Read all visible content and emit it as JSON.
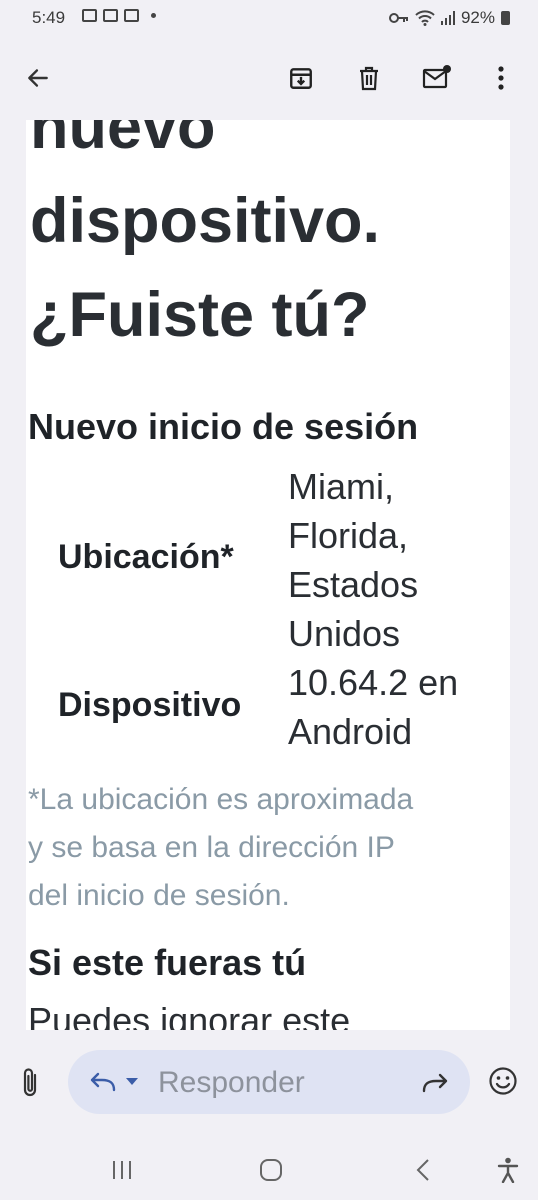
{
  "status_bar": {
    "time": "5:49",
    "battery": "92%"
  },
  "app_bar": {
    "icons": [
      "back-arrow-icon",
      "archive-icon",
      "trash-icon",
      "mark-unread-icon",
      "more-vert-icon"
    ]
  },
  "email": {
    "hero_lines": [
      "nuevo",
      "dispositivo.",
      "¿Fuiste tú?"
    ],
    "new_login_title": "Nuevo inicio de sesión",
    "location": {
      "label": "Ubicación*",
      "value_lines": [
        "Miami,",
        "Florida,",
        "Estados",
        "Unidos"
      ]
    },
    "device": {
      "label": "Dispositivo",
      "value_lines": [
        "10.64.2 en",
        "Android"
      ]
    },
    "note_lines": [
      "*La ubicación es aproximada",
      "y se basa en la dirección IP",
      "del inicio de sesión."
    ],
    "if_you_title": "Si este fueras tú",
    "body_cut": "Puedes ignorar este"
  },
  "reply_bar": {
    "placeholder": "Responder"
  },
  "colors": {
    "background": "#f1f0f5",
    "reply_pill": "#dfe3f3",
    "note_text": "#8a9aa6",
    "accent": "#3b5da8"
  }
}
